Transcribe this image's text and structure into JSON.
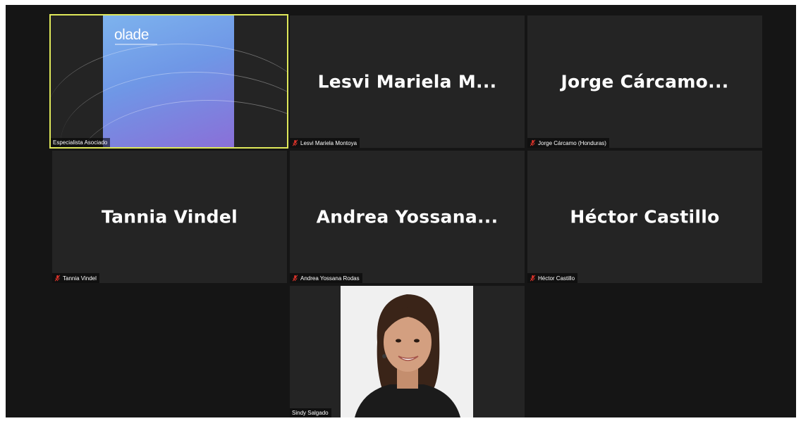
{
  "participants": [
    {
      "display_name": "",
      "label": "Especialista Asociado",
      "muted": false,
      "active": true
    },
    {
      "display_name": "Lesvi  Mariela  M...",
      "label": "Lesvi Mariela Montoya",
      "muted": true
    },
    {
      "display_name": "Jorge  Cárcamo...",
      "label": "Jorge Cárcamo (Honduras)",
      "muted": true
    },
    {
      "display_name": "Tannia Vindel",
      "label": "Tannia Vindel",
      "muted": true
    },
    {
      "display_name": "Andrea  Yossana...",
      "label": "Andrea Yossana Rodas",
      "muted": true
    },
    {
      "display_name": "Héctor Castillo",
      "label": "Héctor Castillo",
      "muted": true
    },
    {
      "display_name": "",
      "label": "Sindy Salgado",
      "muted": false
    }
  ],
  "shared_content": {
    "logo_text": "olade"
  },
  "colors": {
    "active_speaker": "#dfe85a",
    "muted_icon": "#e0342b",
    "tile_bg": "#242424"
  }
}
